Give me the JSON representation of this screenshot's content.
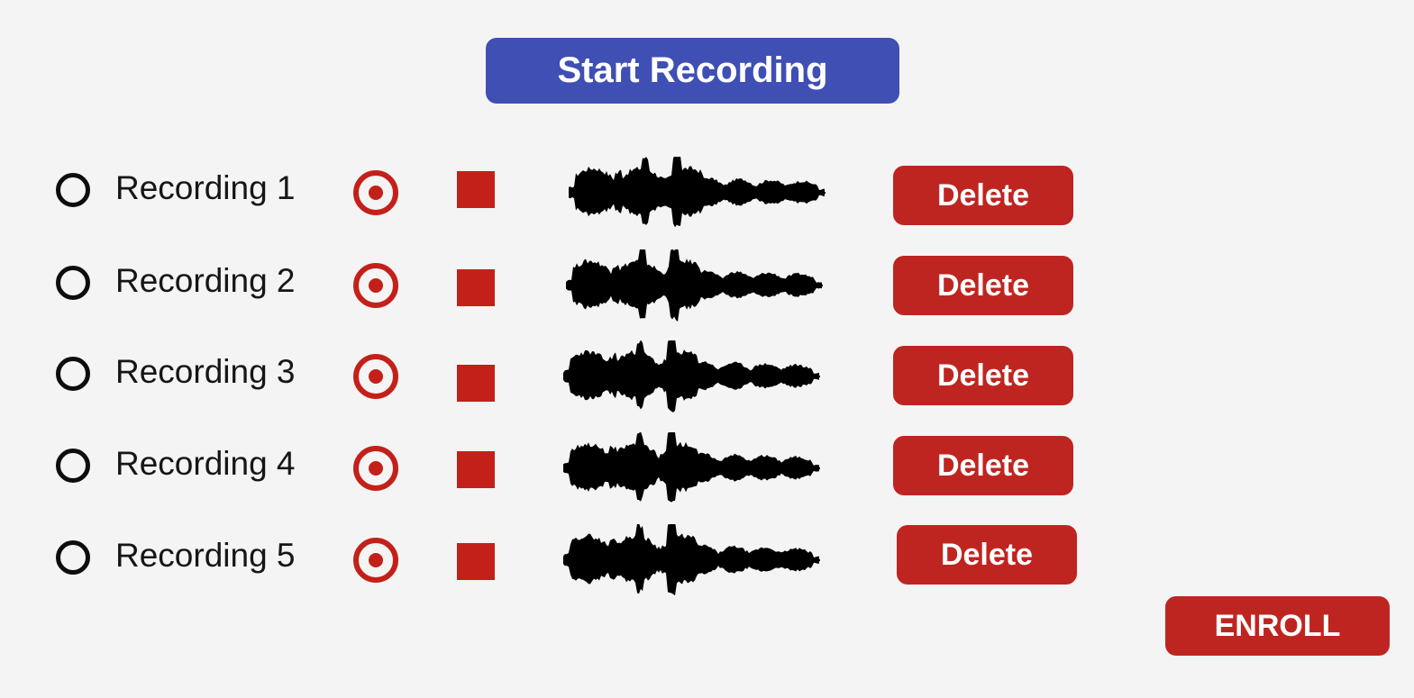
{
  "start_button": {
    "label": "Start Recording"
  },
  "recordings": [
    {
      "label": "Recording 1",
      "delete_label": "Delete"
    },
    {
      "label": "Recording 2",
      "delete_label": "Delete"
    },
    {
      "label": "Recording 3",
      "delete_label": "Delete"
    },
    {
      "label": "Recording 4",
      "delete_label": "Delete"
    },
    {
      "label": "Recording 5",
      "delete_label": "Delete"
    }
  ],
  "enroll_button": {
    "label": "ENROLL"
  },
  "icons": {
    "radio": "radio-unselected-icon",
    "record": "record-target-icon",
    "stop": "stop-square-icon",
    "waveform": "audio-waveform-icon"
  },
  "colors": {
    "primary": "#3f4fb4",
    "danger": "#bf2520",
    "background": "#f4f4f4"
  }
}
